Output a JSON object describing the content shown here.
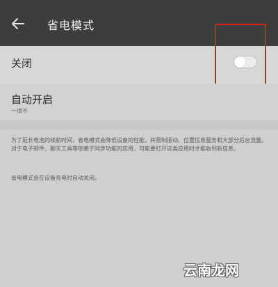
{
  "header": {
    "title": "省电模式"
  },
  "power_saving": {
    "label": "关闭",
    "toggle_state": "off"
  },
  "auto_enable": {
    "title": "自动开启",
    "value": "一律不"
  },
  "description": {
    "main": "为了延长电池的续航时间，省电模式会降低设备的性能，并限制振动、位置信息服务和大部分后台流量。对于电子邮件、聊天工具等依赖于同步功能的应用，可能要打开这类应用时才能收到新信息。",
    "note": "省电模式会在设备充电时自动关闭。"
  },
  "watermark": {
    "text": "云南龙网"
  }
}
